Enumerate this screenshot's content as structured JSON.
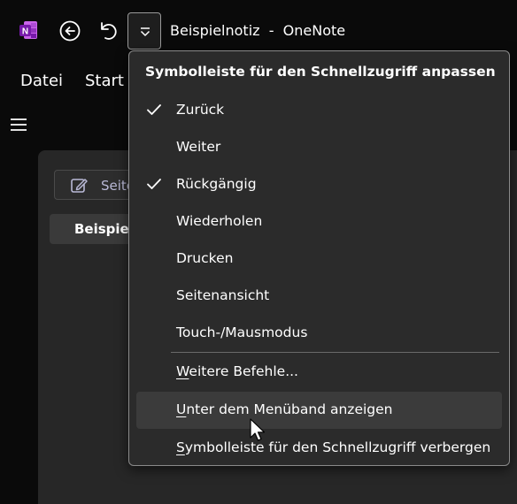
{
  "titlebar": {
    "title": "Beispielnotiz  -  OneNote",
    "app_icon_letter": "N"
  },
  "menubar": {
    "items": [
      "Datei",
      "Start"
    ]
  },
  "content": {
    "new_page_label": "Seite",
    "page_item_label": "Beispiel"
  },
  "qat_menu": {
    "header": "Symbolleiste für den Schnellzugriff anpassen",
    "items": [
      {
        "label": "Zurück",
        "checked": true
      },
      {
        "label": "Weiter",
        "checked": false
      },
      {
        "label": "Rückgängig",
        "checked": true
      },
      {
        "label": "Wiederholen",
        "checked": false
      },
      {
        "label": "Drucken",
        "checked": false
      },
      {
        "label": "Seitenansicht",
        "checked": false
      },
      {
        "label": "Touch-/Mausmodus",
        "checked": false
      }
    ],
    "more_commands": {
      "first": "W",
      "rest": "eitere Befehle..."
    },
    "show_below": {
      "first": "U",
      "rest": "nter dem Menüband anzeigen"
    },
    "hide_toolbar": {
      "first": "S",
      "rest": "ymbolleiste für den Schnellzugriff verbergen"
    }
  },
  "colors": {
    "onenote_purple": "#7f3fbf",
    "menu_background": "#2b2b2b",
    "hover_background": "#3b3b3b"
  }
}
